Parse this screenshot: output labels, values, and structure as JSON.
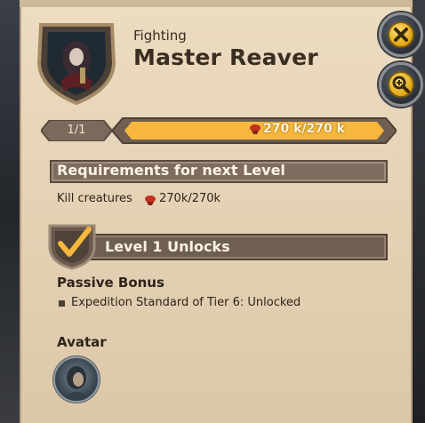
{
  "header": {
    "category": "Fighting",
    "title": "Master Reaver"
  },
  "progress": {
    "level_label": "1/1",
    "value_text": "270 k/270 k",
    "fill": 1.0
  },
  "requirements": {
    "title": "Requirements for next Level",
    "line_label": "Kill creatures",
    "line_value": "270k/270k"
  },
  "unlocks": {
    "title": "Level 1 Unlocks",
    "passive_title": "Passive Bonus",
    "passive_items": [
      "Expedition Standard of Tier 6: Unlocked"
    ],
    "avatar_title": "Avatar"
  },
  "icons": {
    "close": "close-icon",
    "zoom": "zoom-in-icon",
    "kill": "creature-kill-icon",
    "check": "checkmark-icon"
  },
  "colors": {
    "bar_fill": "#f6b73c",
    "panel": "#e8d7bc",
    "header_box": "#7e6c5e"
  }
}
